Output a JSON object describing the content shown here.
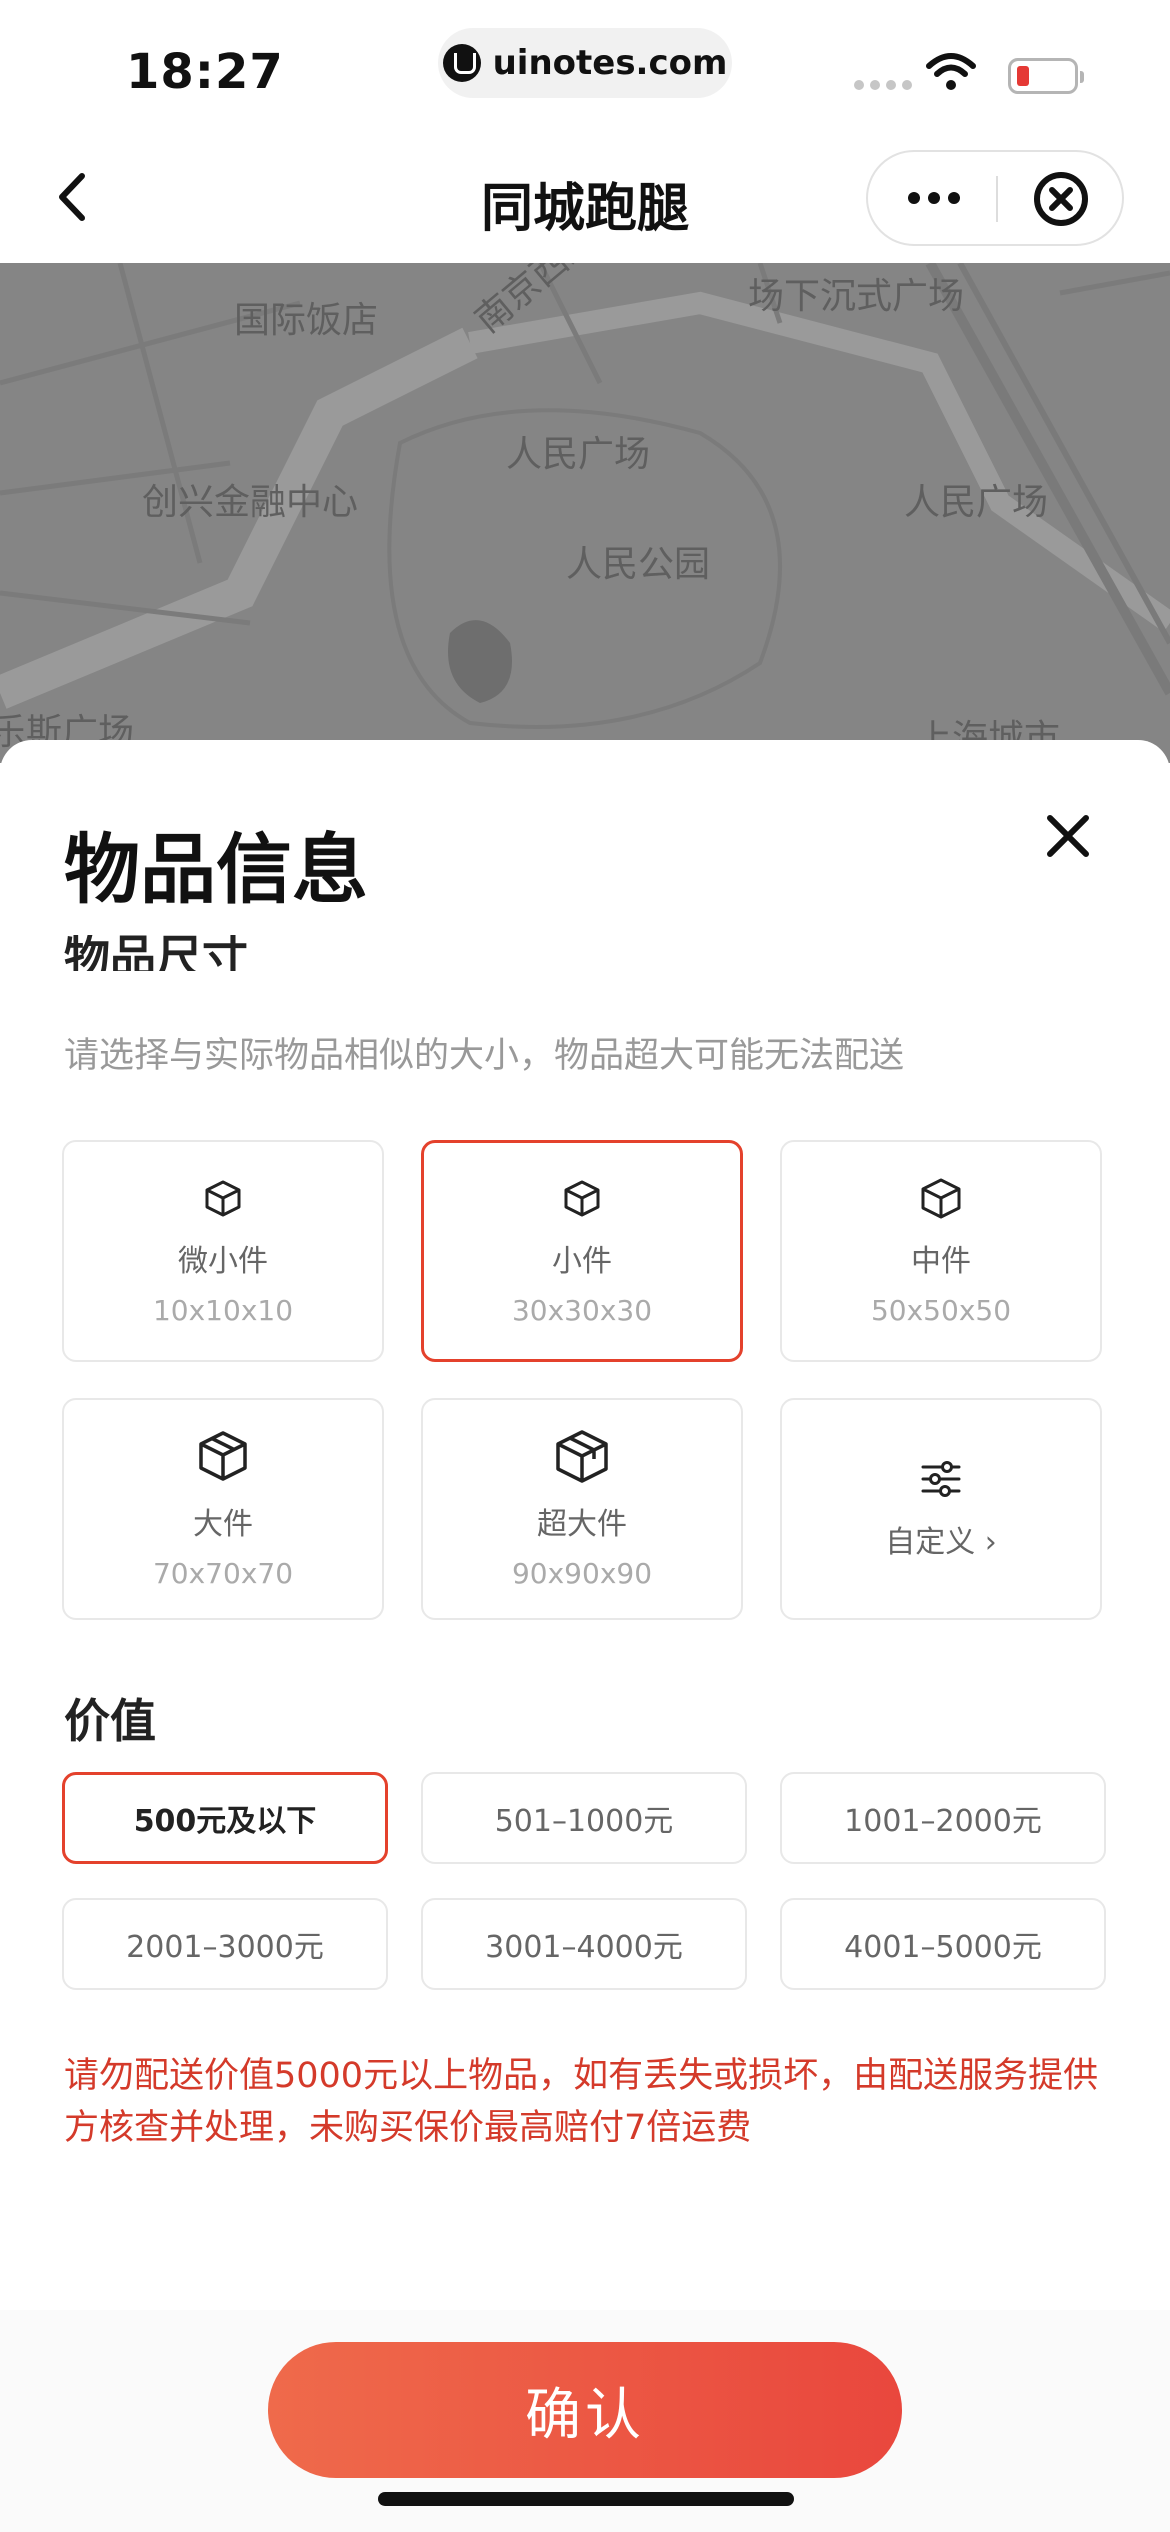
{
  "status": {
    "time": "18:27",
    "url": "uinotes.com"
  },
  "nav": {
    "title": "同城跑腿"
  },
  "map": {
    "labels": [
      "国际饭店",
      "南京西路",
      "场下沉式广场",
      "人民广场",
      "创兴金融中心",
      "人民广场",
      "人民公园",
      "乐斯广场",
      "上海城市"
    ]
  },
  "sheet": {
    "title": "物品信息",
    "section_size_title": "物品尺寸",
    "hint": "请选择与实际物品相似的大小，物品超大可能无法配送",
    "sizes": [
      {
        "name": "微小件",
        "dim": "10x10x10",
        "icon": "box-icon"
      },
      {
        "name": "小件",
        "dim": "30x30x30",
        "icon": "box-icon",
        "selected": true
      },
      {
        "name": "中件",
        "dim": "50x50x50",
        "icon": "box-icon"
      },
      {
        "name": "大件",
        "dim": "70x70x70",
        "icon": "box-icon"
      },
      {
        "name": "超大件",
        "dim": "90x90x90",
        "icon": "box-icon"
      }
    ],
    "custom_label": "自定义 ›",
    "value_title": "价值",
    "values": [
      "500元及以下",
      "501–1000元",
      "1001–2000元",
      "2001–3000元",
      "3001–4000元",
      "4001–5000元"
    ],
    "selected_value": "500元及以下",
    "warning": "请勿配送价值5000元以上物品，如有丢失或损坏，由配送服务提供方核查并处理，未购买保价最高赔付7倍运费",
    "confirm_label": "确认"
  },
  "colors": {
    "accent": "#e4412c",
    "button_start": "#ef6a4b",
    "button_end": "#e9473d",
    "warning": "#d43a2a"
  }
}
